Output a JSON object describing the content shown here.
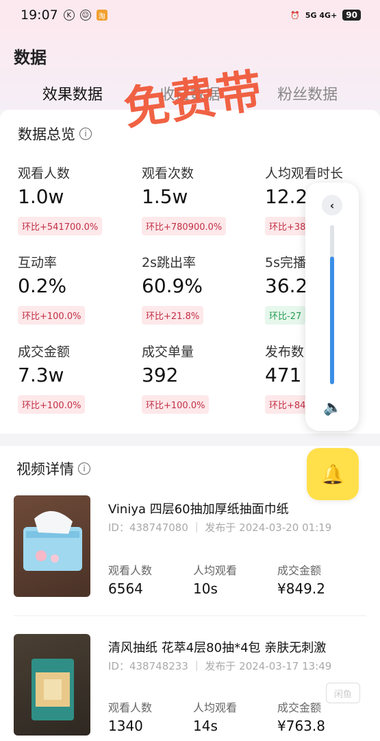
{
  "status": {
    "time": "19:07",
    "battery": "90",
    "network": "5G 4G+"
  },
  "page": {
    "title": "数据"
  },
  "tabs": [
    {
      "label": "效果数据",
      "active": true
    },
    {
      "label": "收益数据",
      "active": false
    },
    {
      "label": "粉丝数据",
      "active": false
    }
  ],
  "watermark": "免费带",
  "overview": {
    "title": "数据总览",
    "metrics": [
      {
        "label": "观看人数",
        "value": "1.0w",
        "change": "环比+541700.0%"
      },
      {
        "label": "观看次数",
        "value": "1.5w",
        "change": "环比+780900.0%"
      },
      {
        "label": "人均观看时长",
        "value": "12.2s",
        "change": "环比+38"
      },
      {
        "label": "互动率",
        "value": "0.2%",
        "change": "环比+100.0%"
      },
      {
        "label": "2s跳出率",
        "value": "60.9%",
        "change": "环比+21.8%"
      },
      {
        "label": "5s完播",
        "value": "36.2",
        "change": "环比-27"
      },
      {
        "label": "成交金额",
        "value": "7.3w",
        "change": "环比+100.0%"
      },
      {
        "label": "成交单量",
        "value": "392",
        "change": "环比+100.0%"
      },
      {
        "label": "发布数",
        "value": "471",
        "change": "环比+84"
      }
    ]
  },
  "volume_panel": {
    "level_percent": 80
  },
  "details": {
    "title": "视频详情",
    "videos": [
      {
        "title": "Viniya 四层60抽加厚纸抽面巾纸",
        "meta": "ID：438747080 ｜ 发布于 2024-03-20 01:19",
        "stats": [
          {
            "label": "观看人数",
            "value": "6564"
          },
          {
            "label": "人均观看",
            "value": "10s"
          },
          {
            "label": "成交金额",
            "value": "¥849.2"
          }
        ]
      },
      {
        "title": "清风抽纸 花萃4层80抽*4包 亲肤无刺激",
        "meta": "ID：438748233 ｜ 发布于 2024-03-17 13:49",
        "stats": [
          {
            "label": "观看人数",
            "value": "1340"
          },
          {
            "label": "人均观看",
            "value": "14s"
          },
          {
            "label": "成交金额",
            "value": "¥763.8"
          }
        ]
      }
    ]
  },
  "corner_watermark": "闲鱼"
}
